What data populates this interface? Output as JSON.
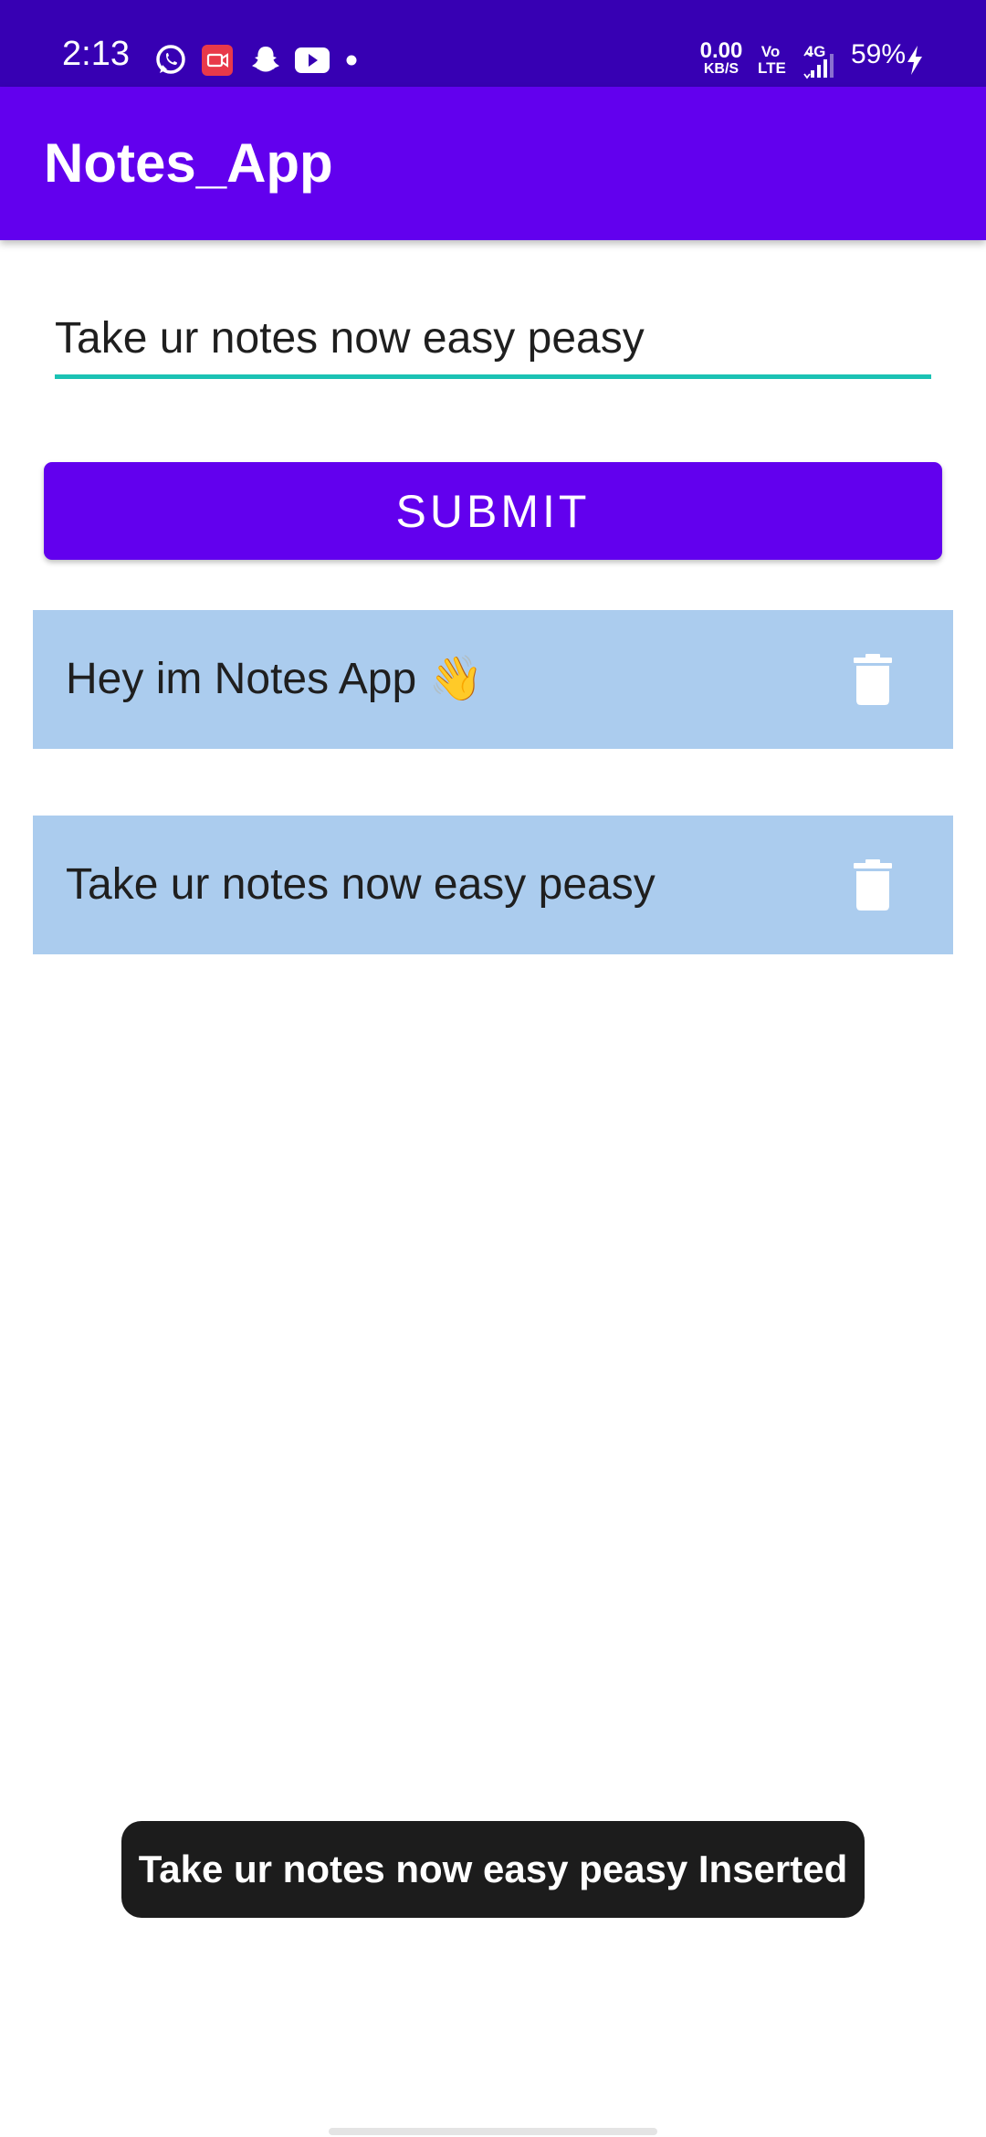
{
  "status_bar": {
    "time": "2:13",
    "notification_icons": [
      "whatsapp-icon",
      "screen-record-icon",
      "snapchat-icon",
      "youtube-icon",
      "more-notifications-dot-icon"
    ],
    "net_speed_value": "0.00",
    "net_speed_unit": "KB/S",
    "volte_top": "Vo",
    "volte_bottom": "LTE",
    "network_type": "4G",
    "battery_percent": "59%",
    "colors": {
      "background": "#3700B3"
    }
  },
  "app_bar": {
    "title": "Notes_App",
    "colors": {
      "background": "#6200EE"
    }
  },
  "note_input": {
    "value": "Take ur notes now easy peasy",
    "underline_color": "#1BC2B4"
  },
  "submit_button": {
    "label": "SUBMIT",
    "color": "#6200EE"
  },
  "notes": [
    {
      "text": "Hey im Notes App 👋",
      "delete_icon": "trash-icon"
    },
    {
      "text": "Take ur notes now easy peasy",
      "delete_icon": "trash-icon"
    }
  ],
  "note_card_color": "#ABCCEE",
  "toast": {
    "message": "Take ur notes now easy peasy Inserted"
  }
}
